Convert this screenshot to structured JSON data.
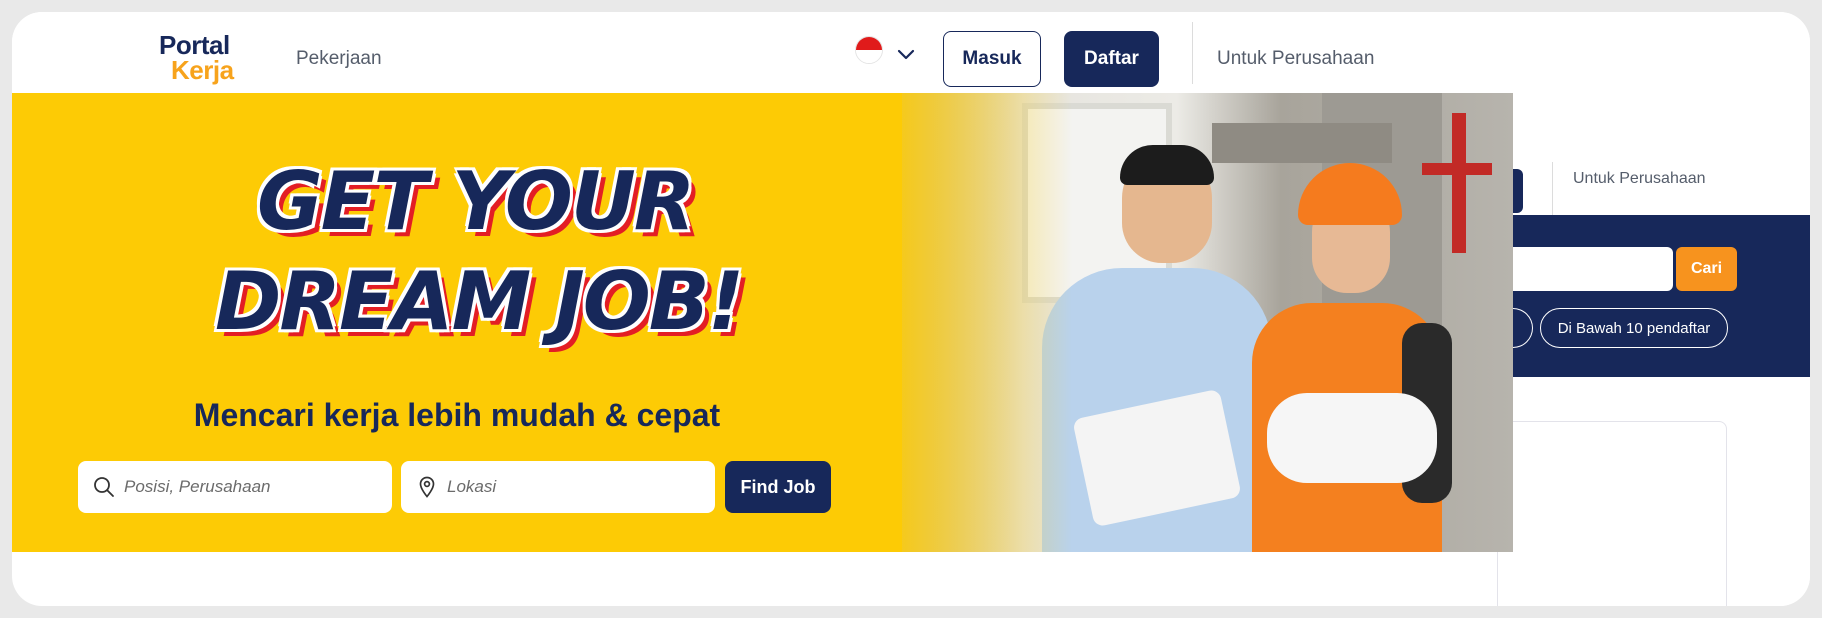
{
  "header": {
    "logo": {
      "line1": "Portal",
      "line2": "Kerja"
    },
    "nav_jobs": "Pekerjaan",
    "language_flag": "indonesia-flag",
    "login_label": "Masuk",
    "register_label": "Daftar",
    "for_company": "Untuk Perusahaan"
  },
  "hero": {
    "headline_line1": "GET YOUR",
    "headline_line2": "DREAM JOB!",
    "subheading": "Mencari kerja lebih mudah & cepat",
    "position_placeholder": "Posisi, Perusahaan",
    "location_placeholder": "Lokasi",
    "find_button": "Find Job"
  },
  "background_page": {
    "for_company": "Untuk Perusahaan",
    "search_button": "Cari",
    "filter_chip": "Di Bawah 10 pendaftar"
  },
  "colors": {
    "navy": "#17285a",
    "yellow": "#fdcb05",
    "orange": "#f7931e",
    "logo_orange": "#f7a31c",
    "red_outline": "#e31e24"
  }
}
